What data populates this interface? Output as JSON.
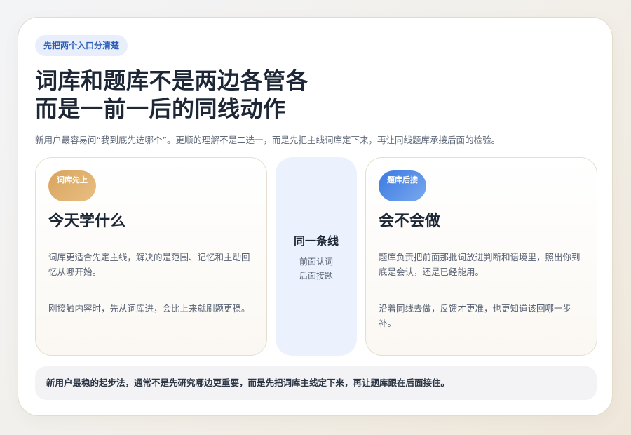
{
  "tag": "先把两个入口分清楚",
  "title": {
    "line1": "词库和题库不是两边各管各",
    "line2": "而是一前一后的同线动作"
  },
  "subtitle": "新用户最容易问“我到底先选哪个”。更顺的理解不是二选一，而是先把主线词库定下来，再让同线题库承接后面的检验。",
  "left_panel": {
    "badge": "词库先上",
    "title": "今天学什么",
    "text1": "词库更适合先定主线，解决的是范围、记忆和主动回忆从哪开始。",
    "text2": "刚接触内容时，先从词库进，会比上来就刷题更稳。"
  },
  "middle": {
    "title": "同一条线",
    "sub1": "前面认词",
    "sub2": "后面接题"
  },
  "right_panel": {
    "badge": "题库后接",
    "title": "会不会做",
    "text1": "题库负责把前面那批词放进判断和语境里，照出你到底是会认，还是已经能用。",
    "text2": "沿着同线去做，反馈才更准，也更知道该回哪一步补。"
  },
  "footer": "新用户最稳的起步法，通常不是先研究哪边更重要，而是先把词库主线定下来，再让题库跟在后面接住。",
  "colors": {
    "accent_blue": "#2c5fb8",
    "badge_gold": "#d9a45e",
    "badge_blue": "#3a7ae2",
    "middle_bg": "#ecf2fd"
  }
}
